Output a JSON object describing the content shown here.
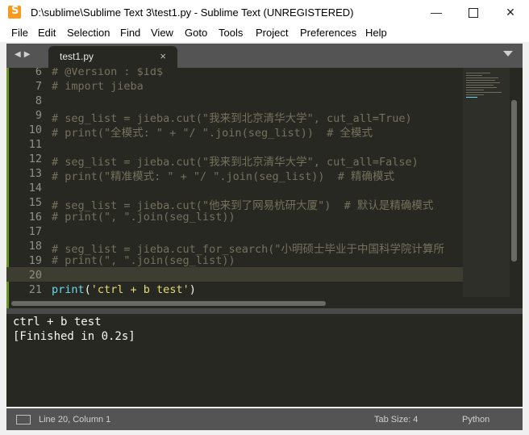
{
  "window": {
    "title": "D:\\sublime\\Sublime Text 3\\test1.py - Sublime Text (UNREGISTERED)"
  },
  "menu": [
    "File",
    "Edit",
    "Selection",
    "Find",
    "View",
    "Goto",
    "Tools",
    "Project",
    "Preferences",
    "Help"
  ],
  "tabs": [
    {
      "label": "test1.py",
      "close": "×"
    }
  ],
  "editor": {
    "lines": [
      {
        "n": "6",
        "text": "# @Version : $Id$"
      },
      {
        "n": "7",
        "text": "# import jieba"
      },
      {
        "n": "8",
        "text": ""
      },
      {
        "n": "9",
        "text": "# seg_list = jieba.cut(\"我来到北京清华大学\", cut_all=True)"
      },
      {
        "n": "10",
        "text": "# print(\"全模式: \" + \"/ \".join(seg_list))  # 全模式"
      },
      {
        "n": "11",
        "text": ""
      },
      {
        "n": "12",
        "text": "# seg_list = jieba.cut(\"我来到北京清华大学\", cut_all=False)"
      },
      {
        "n": "13",
        "text": "# print(\"精准模式: \" + \"/ \".join(seg_list))  # 精确模式"
      },
      {
        "n": "14",
        "text": ""
      },
      {
        "n": "15",
        "text": "# seg_list = jieba.cut(\"他来到了网易杭研大厦\")  # 默认是精确模式"
      },
      {
        "n": "16",
        "text": "# print(\", \".join(seg_list))"
      },
      {
        "n": "17",
        "text": ""
      },
      {
        "n": "18",
        "text": "# seg_list = jieba.cut_for_search(\"小明硕士毕业于中国科学院计算所"
      },
      {
        "n": "19",
        "text": "# print(\", \".join(seg_list))"
      },
      {
        "n": "20",
        "text": ""
      },
      {
        "n": "21",
        "fn": "print",
        "open": "(",
        "str": "'ctrl + b test'",
        "close": ")"
      }
    ]
  },
  "output": {
    "lines": [
      "ctrl + b test",
      "[Finished in 0.2s]"
    ]
  },
  "status": {
    "position": "Line 20, Column 1",
    "tab_size": "Tab Size: 4",
    "syntax": "Python"
  },
  "colors": {
    "editor_bg": "#272822",
    "comment": "#75715e",
    "function": "#66d9ef",
    "string": "#e6db74",
    "chrome": "#545454"
  }
}
